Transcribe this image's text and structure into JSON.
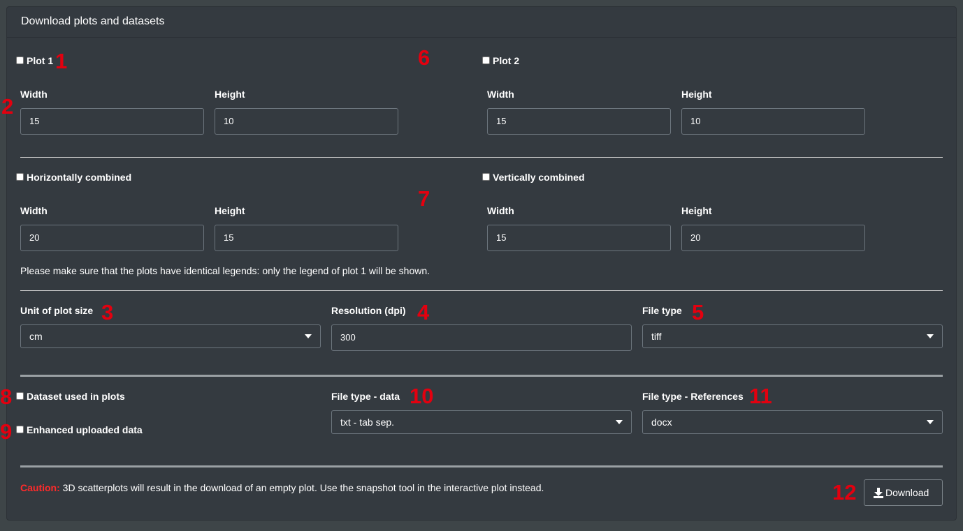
{
  "panel": {
    "title": "Download plots and datasets"
  },
  "plot1": {
    "label": "Plot 1",
    "width_label": "Width",
    "width": "15",
    "height_label": "Height",
    "height": "10"
  },
  "plot2": {
    "label": "Plot 2",
    "width_label": "Width",
    "width": "15",
    "height_label": "Height",
    "height": "10"
  },
  "horizontal": {
    "label": "Horizontally combined",
    "width_label": "Width",
    "width": "20",
    "height_label": "Height",
    "height": "15"
  },
  "vertical": {
    "label": "Vertically combined",
    "width_label": "Width",
    "width": "15",
    "height_label": "Height",
    "height": "20"
  },
  "legend_note": "Please make sure that the plots have identical legends: only the legend of plot 1 will be shown.",
  "unit": {
    "label": "Unit of plot size",
    "value": "cm"
  },
  "resolution": {
    "label": "Resolution (dpi)",
    "value": "300"
  },
  "file_type": {
    "label": "File type",
    "value": "tiff"
  },
  "dataset_used": {
    "label": "Dataset used in plots"
  },
  "enhanced": {
    "label": "Enhanced uploaded data"
  },
  "file_type_data": {
    "label": "File type - data",
    "value": "txt - tab sep."
  },
  "file_type_refs": {
    "label": "File type - References",
    "value": "docx"
  },
  "caution": {
    "prefix": "Caution:",
    "text": "3D scatterplots will result in the download of an empty plot. Use the snapshot tool in the interactive plot instead."
  },
  "download": {
    "label": "Download",
    "icon": "download-icon"
  },
  "markers": [
    "1",
    "2",
    "3",
    "4",
    "5",
    "6",
    "7",
    "8",
    "9",
    "10",
    "11",
    "12"
  ],
  "colors": {
    "background": "#3e4548",
    "panel": "#343a40",
    "marker": "#e3000f",
    "caution": "#ff2a2a"
  }
}
